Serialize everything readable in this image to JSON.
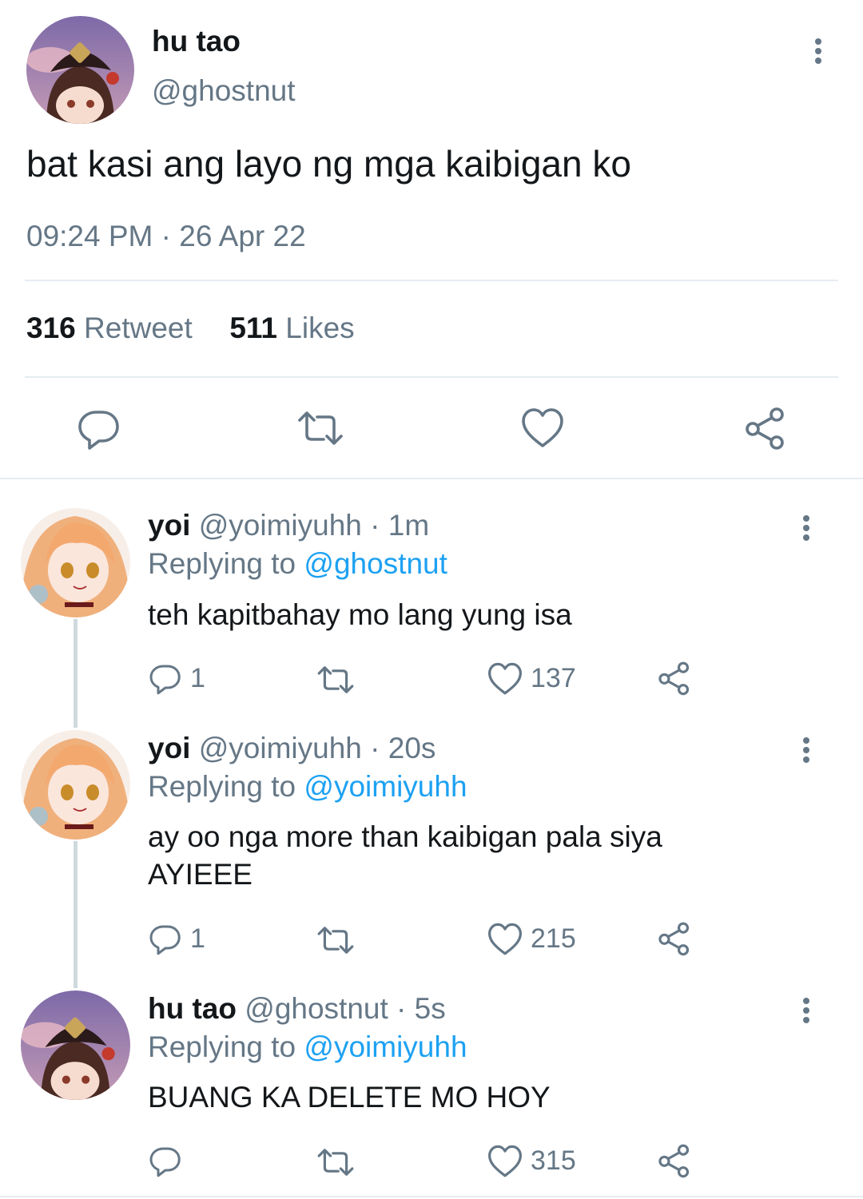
{
  "main_tweet": {
    "display_name": "hu tao",
    "handle": "@ghostnut",
    "text": "bat kasi ang layo ng mga kaibigan ko",
    "timestamp": "09:24 PM · 26 Apr 22",
    "retweet_count": "316",
    "retweet_label": "Retweet",
    "like_count": "511",
    "like_label": "Likes"
  },
  "action_icons": [
    "reply-icon",
    "retweet-icon",
    "like-icon",
    "share-icon"
  ],
  "replies": [
    {
      "display_name": "yoi",
      "handle_time": "@yoimiyuhh · 1m",
      "replying_prefix": "Replying to",
      "replying_to": "@ghostnut",
      "text_line1": "teh kapitbahay mo lang yung isa",
      "text_line2": "",
      "reply_count": "1",
      "like_count": "137"
    },
    {
      "display_name": "yoi",
      "handle_time": "@yoimiyuhh · 20s",
      "replying_prefix": "Replying to",
      "replying_to": "@yoimiyuhh",
      "text_line1": "ay oo nga more than kaibigan pala siya",
      "text_line2": "AYIEEE",
      "reply_count": "1",
      "like_count": "215"
    },
    {
      "display_name": "hu tao",
      "handle_time": "@ghostnut · 5s",
      "replying_prefix": "Replying to",
      "replying_to": "@yoimiyuhh",
      "text_line1": "BUANG KA DELETE MO HOY",
      "text_line2": "",
      "reply_count": "",
      "like_count": "315"
    }
  ],
  "colors": {
    "text": "#14171a",
    "muted": "#657786",
    "link": "#1da1f2",
    "divider": "#e6ecf0"
  }
}
